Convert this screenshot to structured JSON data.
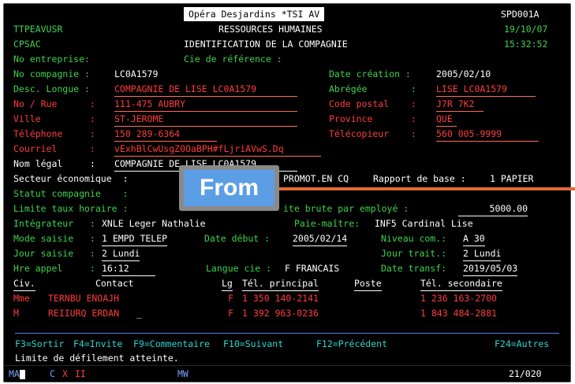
{
  "title_bar": {
    "system_name": "Opéra Desjardins *TSI AV",
    "program_id": "SPD001A"
  },
  "header": {
    "user": "TTPEAVUSR",
    "subtitle": "RESSOURCES HUMAINES",
    "date": "19/10/07",
    "library": "CPSAC",
    "screen_title": "IDENTIFICATION DE LA COMPAGNIE",
    "time": "15:32:52"
  },
  "form": {
    "no_entreprise_label": "No entreprise:",
    "cie_reference_label": "Cie de référence :",
    "no_compagnie_label": "No compagnie : ",
    "no_compagnie": "LC0A1579",
    "date_creation_label": "Date création : ",
    "date_creation": "2005/02/10",
    "desc_longue_label": "Desc. Longue : ",
    "desc_longue": "COMPAGNIE DE LISE LC0A1579",
    "abregee_label": "Abrégée        : ",
    "abregee": "LISE LC0A1579",
    "no_rue_label": "No / Rue      : ",
    "no_rue": "111-475 AUBRY",
    "code_postal_label": "Code postal    : ",
    "code_postal": "J7R 7K2",
    "ville_label": "Ville         : ",
    "ville": "ST-JEROME",
    "province_label": "Province       : ",
    "province": "QUE",
    "telephone_label": "Téléphone     : ",
    "telephone": "150 289-6364",
    "telecopieur_label": "Télécopieur    : ",
    "telecopieur": "560 005-9999",
    "courriel_label": "Courriel      : ",
    "courriel": "vExhBlCwUsgZ0OaBPH#fLjriAVwS.Dq",
    "nom_legal_label": "Nom légal     : ",
    "nom_legal": "COMPAGNIE DE LISE LC0A1579",
    "secteur_label": "Secteur économique  : ",
    "secteur_value": "PROMOT.EN CQ",
    "rapport_label": "Rapport de base : ",
    "rapport_value": "1 PAPIER",
    "statut_label": "Statut compagnie    :",
    "limite_taux_label": "Limite taux horaire :",
    "limite_brute_label": "ite brute par employé : ",
    "limite_brute": "5000.00",
    "integrateur_label": "Intégrateur   : ",
    "integrateur": "XNLE Leger Nathalie",
    "paie_maitre_label": "Paie-maître: ",
    "paie_maitre": "INF5 Cardinal Lise",
    "mode_saisie_label": "Mode saisie   : ",
    "mode_saisie": "1 EMPD TELEP",
    "date_debut_label": "Date début : ",
    "date_debut": "2005/02/14",
    "niveau_com_label": "Niveau com.: ",
    "niveau_com": "A 30",
    "jour_saisie_label": "Jour saisie   : ",
    "jour_saisie": "2 Lundi",
    "jour_trait_label": "Jour trait.: ",
    "jour_trait": "2 Lundi",
    "hre_appel_label": "Hre appel     : ",
    "hre_appel": "16:12",
    "langue_cie_label": "Langue cie : ",
    "langue_cie": "F FRANCAIS",
    "date_transf_label": "Date transf: ",
    "date_transf": "2019/05/03"
  },
  "contacts": {
    "headers": {
      "civ": "Civ.",
      "contact": "Contact",
      "lg": "Lg",
      "tel_principal": "Tél. principal",
      "poste": "Poste",
      "tel_secondaire": "Tél. secondaire"
    },
    "rows": [
      {
        "civ": "Mme",
        "contact": "TERNBU ENOAJH",
        "lg": "F",
        "tel_principal": "1 350 140-2141",
        "tel_secondaire": "1 236 163-2700"
      },
      {
        "civ": "M",
        "contact": "REIIURQ ERDAN",
        "lg": "F",
        "tel_principal": "1 392 963-0236",
        "tel_secondaire": "1 843 484-2881"
      }
    ]
  },
  "function_keys": {
    "f3": "F3=Sortir",
    "f4": "F4=Invite",
    "f9": "F9=Commentaire",
    "f10": "F10=Suivant",
    "f12": "F12=Précédent",
    "f24": "F24=Autres"
  },
  "message": "Limite de défilement atteinte.",
  "status_bar": {
    "ma": "MA",
    "c": "C",
    "x": "X",
    "ii": "II",
    "mw": "MW",
    "position": "21/020"
  },
  "overlay": {
    "label": "From"
  },
  "colors": {
    "background": "#000000",
    "label_green": "#3fd24d",
    "value_white": "#ffffff",
    "cyan": "#2fd3d3",
    "badge_blue": "#5b9ee6",
    "arrow_orange": "#e36b32"
  }
}
